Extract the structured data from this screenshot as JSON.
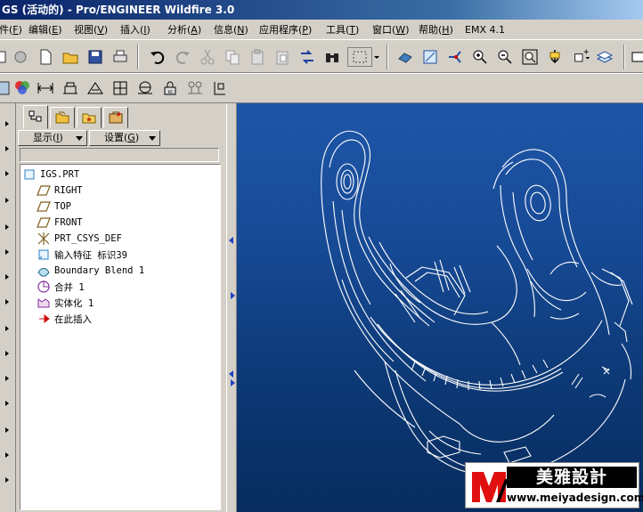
{
  "window": {
    "title": "GS (活动的) - Pro/ENGINEER Wildfire 3.0"
  },
  "menubar": {
    "items": [
      {
        "label": "文件",
        "key": "F"
      },
      {
        "label": "编辑",
        "key": "E"
      },
      {
        "label": "视图",
        "key": "V"
      },
      {
        "label": "插入",
        "key": "I"
      },
      {
        "label": "分析",
        "key": "A"
      },
      {
        "label": "信息",
        "key": "N"
      },
      {
        "label": "应用程序",
        "key": "P"
      },
      {
        "label": "工具",
        "key": "T"
      },
      {
        "label": "窗口",
        "key": "W"
      },
      {
        "label": "帮助",
        "key": "H"
      },
      {
        "label": "EMX 4.1",
        "key": ""
      }
    ]
  },
  "navigator": {
    "tabs": [
      "model-tree-tab",
      "folder-browser-tab",
      "favorites-tab",
      "connections-tab"
    ],
    "show_label": "显示",
    "show_key": "I",
    "settings_label": "设置",
    "settings_key": "G"
  },
  "model_tree": {
    "items": [
      {
        "label": "IGS.PRT",
        "icon": "part-icon"
      },
      {
        "label": "RIGHT",
        "icon": "datum-plane-icon"
      },
      {
        "label": "TOP",
        "icon": "datum-plane-icon"
      },
      {
        "label": "FRONT",
        "icon": "datum-plane-icon"
      },
      {
        "label": "PRT_CSYS_DEF",
        "icon": "csys-icon"
      },
      {
        "label": "输入特征 标识39",
        "icon": "import-feature-icon"
      },
      {
        "label": "Boundary Blend 1",
        "icon": "boundary-blend-icon"
      },
      {
        "label": "合并 1",
        "icon": "merge-icon"
      },
      {
        "label": "实体化 1",
        "icon": "solidify-icon"
      },
      {
        "label": "在此插入",
        "icon": "insert-here-icon"
      }
    ]
  },
  "watermark": {
    "title": "美雅設計",
    "url": "www.meiyadesign.com",
    "logo": "meiya-logo"
  },
  "colors": {
    "graphics_top": "#1e56a8",
    "graphics_bottom": "#082c5e",
    "wireframe": "#ffffff",
    "titlebar": "#0a246a"
  }
}
